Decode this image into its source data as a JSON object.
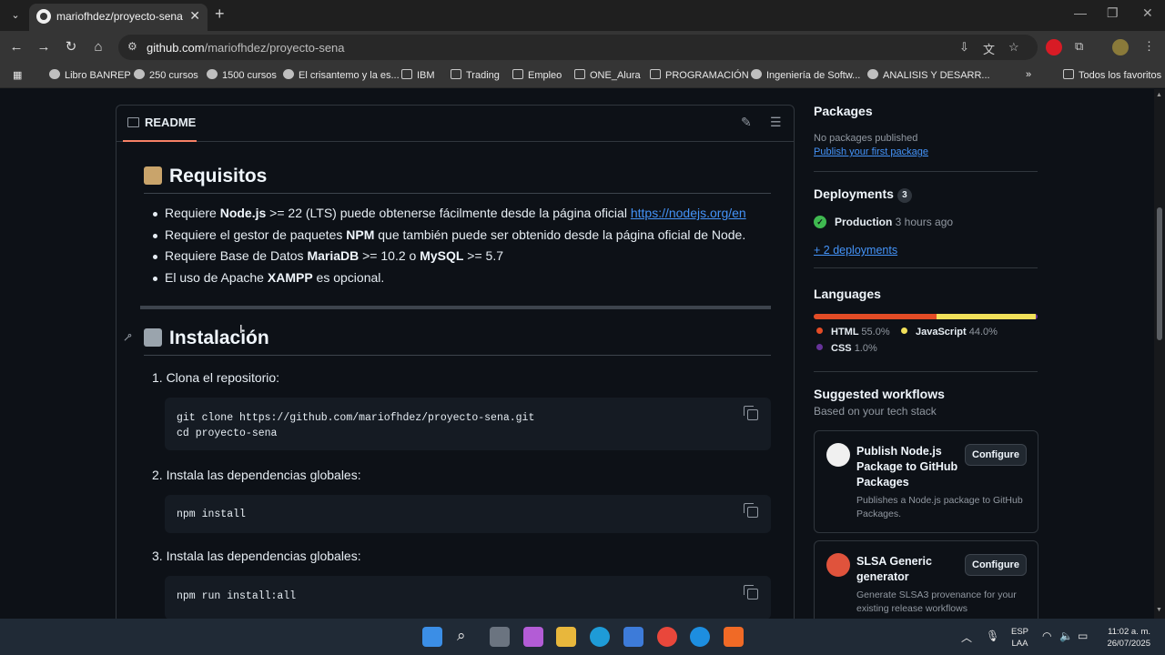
{
  "browser": {
    "tab_title": "mariofhdez/proyecto-sena",
    "url_host": "github.com",
    "url_path": "/mariofhdez/proyecto-sena",
    "bookmarks": [
      {
        "label": "Libro BANREP",
        "type": "globe"
      },
      {
        "label": "250 cursos",
        "type": "globe"
      },
      {
        "label": "1500 cursos",
        "type": "globe"
      },
      {
        "label": "El crisantemo y la es...",
        "type": "globe"
      },
      {
        "label": "IBM",
        "type": "folder"
      },
      {
        "label": "Trading",
        "type": "folder"
      },
      {
        "label": "Empleo",
        "type": "folder"
      },
      {
        "label": "ONE_Alura",
        "type": "folder"
      },
      {
        "label": "PROGRAMACIÓN",
        "type": "folder"
      },
      {
        "label": "Ingeniería de Softw...",
        "type": "globe"
      },
      {
        "label": "ANALISIS Y DESARR...",
        "type": "globe"
      }
    ],
    "all_bookmarks": "Todos los favoritos"
  },
  "readme": {
    "tab_label": "README",
    "requisitos": {
      "heading": "Requisitos",
      "items": [
        {
          "pre": "Requiere ",
          "b1": "Node.js",
          "mid": " >= 22 (LTS) puede obtenerse fácilmente desde la página oficial ",
          "link": "https://nodejs.org/en"
        },
        {
          "pre": "Requiere el gestor de paquetes ",
          "b1": "NPM",
          "mid": " que también puede ser obtenido desde la página oficial de Node."
        },
        {
          "pre": "Requiere Base de Datos ",
          "b1": "MariaDB",
          "mid": " >= 10.2 o ",
          "b2": "MySQL",
          "post": " >= 5.7"
        },
        {
          "pre": "El uso de Apache ",
          "b1": "XAMPP",
          "mid": " es opcional."
        }
      ]
    },
    "instalacion": {
      "heading": "Instalación",
      "steps": [
        {
          "label": "1. Clona el repositorio:",
          "code": "git clone https://github.com/mariofhdez/proyecto-sena.git\ncd proyecto-sena"
        },
        {
          "label": "2. Instala las dependencias globales:",
          "code": "npm install"
        },
        {
          "label": "3. Instala las dependencias globales:",
          "code": "npm run install:all"
        }
      ]
    }
  },
  "sidebar": {
    "packages": {
      "title": "Packages",
      "empty": "No packages published",
      "link": "Publish your first package"
    },
    "deployments": {
      "title": "Deployments",
      "count": "3",
      "env": "Production",
      "time": "3 hours ago",
      "more": "+ 2 deployments"
    },
    "languages": {
      "title": "Languages",
      "items": [
        {
          "name": "HTML",
          "percent": "55.0%",
          "value": 55.0,
          "color": "#e34c26"
        },
        {
          "name": "JavaScript",
          "percent": "44.0%",
          "value": 44.0,
          "color": "#f1e05a"
        },
        {
          "name": "CSS",
          "percent": "1.0%",
          "value": 1.0,
          "color": "#663399"
        }
      ]
    },
    "workflows": {
      "title": "Suggested workflows",
      "subtitle": "Based on your tech stack",
      "cards": [
        {
          "name": "Publish Node.js Package to GitHub Packages",
          "desc": "Publishes a Node.js package to GitHub Packages.",
          "button": "Configure"
        },
        {
          "name": "SLSA Generic generator",
          "desc": "Generate SLSA3 provenance for your existing release workflows",
          "button": "Configure"
        }
      ]
    }
  },
  "taskbar": {
    "lang1": "ESP",
    "lang2": "LAA",
    "time": "11:02 a. m.",
    "date": "26/07/2025"
  }
}
